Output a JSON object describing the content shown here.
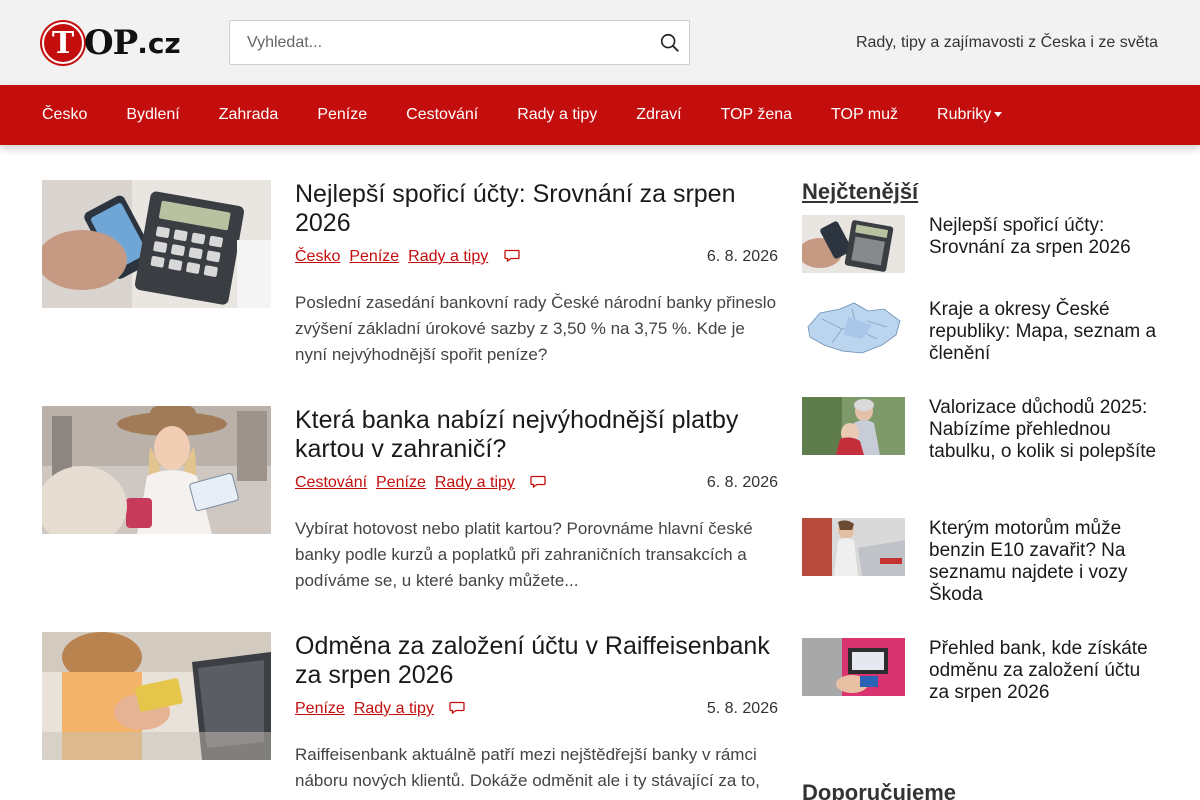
{
  "header": {
    "logo_t": "T",
    "logo_op": "OP",
    "logo_cz": ".cz",
    "search_placeholder": "Vyhledat...",
    "tagline": "Rady, tipy a zajímavosti z Česka i ze světa"
  },
  "nav": {
    "items": [
      "Česko",
      "Bydlení",
      "Zahrada",
      "Peníze",
      "Cestování",
      "Rady a tipy",
      "Zdraví",
      "TOP žena",
      "TOP muž",
      "Rubriky"
    ]
  },
  "articles": [
    {
      "title": "Nejlepší spořicí účty: Srovnání za srpen 2026",
      "tags": [
        "Česko",
        "Peníze",
        "Rady a tipy"
      ],
      "date": "6. 8. 2026",
      "perex": "Poslední zasedání bankovní rady České národní banky přineslo zvýšení základní úrokové sazby z 3,50 % na 3,75 %. Kde je nyní nejvýhodnější spořit peníze?"
    },
    {
      "title": "Která banka nabízí nejvýhodnější platby kartou v zahraničí?",
      "tags": [
        "Cestování",
        "Peníze",
        "Rady a tipy"
      ],
      "date": "6. 8. 2026",
      "perex": "Vybírat hotovost nebo platit kartou? Porovnáme hlavní české banky podle kurzů a poplatků při zahraničních transakcích a podíváme se, u které banky můžete..."
    },
    {
      "title": "Odměna za založení účtu v Raiffeisenbank za srpen 2026",
      "tags": [
        "Peníze",
        "Rady a tipy"
      ],
      "date": "5. 8. 2026",
      "perex": "Raiffeisenbank aktuálně patří mezi nejštědřejší banky v rámci náboru nových klientů. Dokáže odměnit ale i ty stávající za to, že jim svěří peníze..."
    }
  ],
  "sidebar": {
    "title": "Nejčtenější",
    "items": [
      "Nejlepší spořicí účty: Srovnání za srpen 2026",
      "Kraje a okresy České republiky: Mapa, seznam a členění",
      "Valorizace důchodů 2025: Nabízíme přehlednou tabulku, o kolik si polepšíte",
      "Kterým motorům může benzin E10 zavařit? Na seznamu najdete i vozy Škoda",
      "Přehled bank, kde získáte odměnu za založení účtu za srpen 2026"
    ],
    "title2": "Doporučujeme"
  },
  "colors": {
    "brand_red": "#c40d0d",
    "header_bg": "#f2f2f2"
  },
  "icons": [
    "search-icon",
    "comment-icon",
    "caret-down-icon"
  ]
}
